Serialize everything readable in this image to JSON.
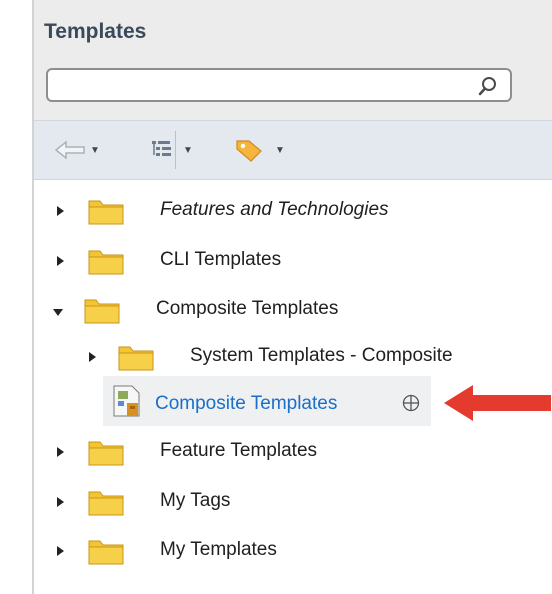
{
  "panel": {
    "title": "Templates",
    "search": {
      "placeholder": "",
      "value": ""
    }
  },
  "toolbar": {
    "items": [
      {
        "icon": "back-arrow-icon"
      },
      {
        "icon": "tree-view-icon"
      },
      {
        "icon": "tag-icon"
      }
    ]
  },
  "tree": {
    "features": "Features and Technologies",
    "cli": "CLI Templates",
    "composite": "Composite Templates",
    "system_composite": "System Templates - Composite",
    "composite_leaf": "Composite Templates",
    "feature": "Feature Templates",
    "my_tags": "My Tags",
    "my_templates": "My Templates"
  },
  "colors": {
    "folder": "#f4c431",
    "link": "#1b6fc9",
    "arrow": "#e53b2f"
  }
}
